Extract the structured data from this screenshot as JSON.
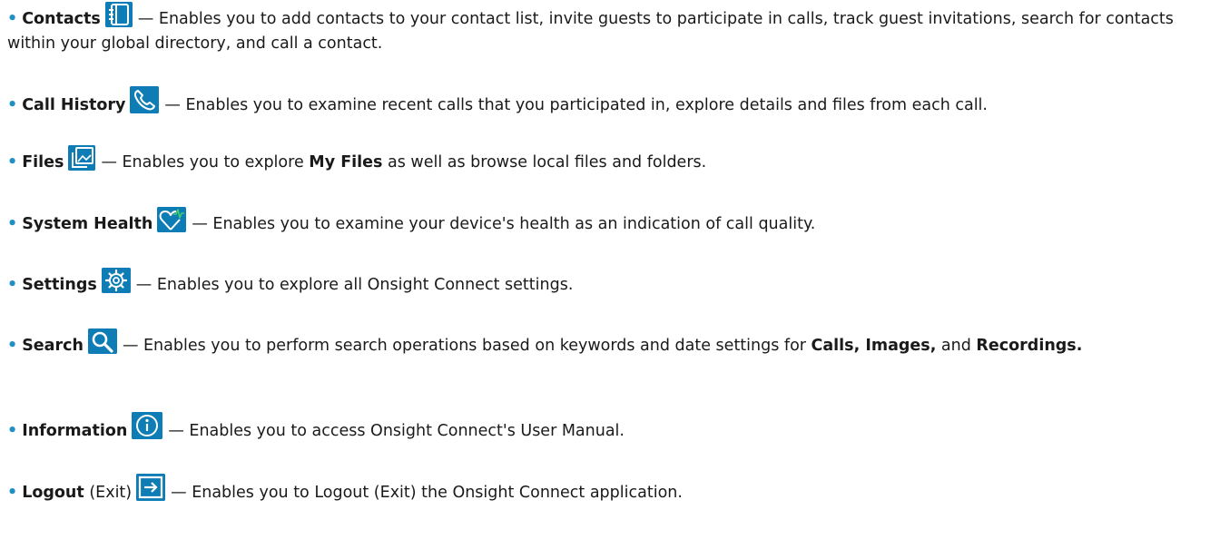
{
  "accent_color": "#0e7cb5",
  "bullet_symbol": "•",
  "features": [
    {
      "name": "Contacts",
      "icon": "contacts-book-icon",
      "description": "— Enables you to add contacts to your contact list, invite guests to participate in calls, track guest invitations, search for contacts within your global directory, and call a contact."
    },
    {
      "name": "Call History",
      "icon": "phone-icon",
      "description": "— Enables you to examine recent calls that you participated in, explore details and files from each call."
    },
    {
      "name": "Files",
      "icon": "image-gallery-icon",
      "desc_before": "— Enables you to explore ",
      "desc_bold": "My Files",
      "desc_after": " as well as browse local files and folders."
    },
    {
      "name": "System Health",
      "icon": "heart-pulse-icon",
      "description": "— Enables you to examine your device's health as an indication of call quality."
    },
    {
      "name": "Settings",
      "icon": "gear-icon",
      "description": "— Enables you to explore all Onsight Connect settings."
    },
    {
      "name": "Search",
      "icon": "search-icon",
      "desc_before": "— Enables you to perform search operations based on keywords and date settings for ",
      "desc_bold": "Calls, Images,",
      "desc_after": " and ",
      "desc_bold2": "Recordings."
    },
    {
      "name": "Information",
      "icon": "info-icon",
      "description": "— Enables you to access Onsight Connect's User Manual."
    },
    {
      "name": "Logout",
      "name_suffix": "(Exit)",
      "icon": "logout-icon",
      "description": "— Enables you to Logout (Exit) the Onsight Connect application."
    }
  ]
}
